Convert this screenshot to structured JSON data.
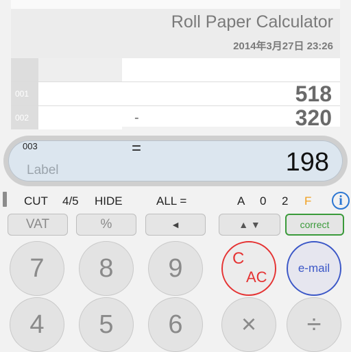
{
  "paper": {
    "title": "Roll Paper Calculator",
    "timestamp": "2014年3月27日 23:26",
    "rows": [
      {
        "index": "001",
        "operator": "",
        "value": "518"
      },
      {
        "index": "002",
        "operator": "-",
        "value": "320"
      }
    ]
  },
  "display": {
    "row_index": "003",
    "operator": "=",
    "label_placeholder": "Label",
    "value": "198"
  },
  "status": {
    "cut": "CUT",
    "rounding": "4/5",
    "hide": "HIDE",
    "all": "ALL =",
    "a": "A",
    "zero": "0",
    "two": "2",
    "f": "F",
    "f_color": "#f0a020"
  },
  "buttons": {
    "vat": "VAT",
    "percent": "%",
    "back": "◄",
    "updown": "▲ ▼",
    "correct": "correct",
    "c": "C",
    "ac": "AC",
    "email": "e-mail",
    "multiply": "×",
    "divide": "÷",
    "digits": [
      "7",
      "8",
      "9",
      "4",
      "5",
      "6"
    ]
  },
  "icons": {
    "info": "i"
  },
  "colors": {
    "accent_red": "#e53333",
    "accent_blue": "#3b57c7",
    "accent_green": "#3a9a3a",
    "info_blue": "#2b76d2"
  }
}
